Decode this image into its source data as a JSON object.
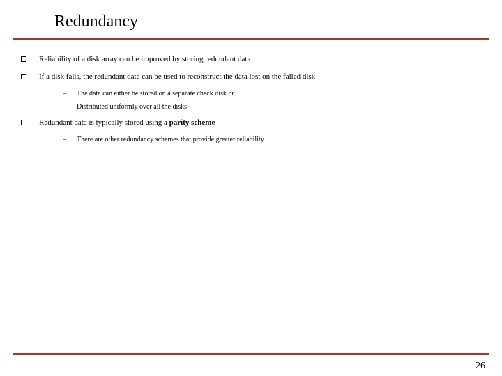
{
  "title": "Redundancy",
  "bullets": {
    "b1": "Reliability of a disk array can be improved by storing redundant data",
    "b2": "If a disk fails, the redundant data can be used to reconstruct the data lost on the failed disk",
    "b2s1": "The data can either be stored on a separate check disk or",
    "b2s2": "Distributed uniformly over all the disks",
    "b3_pre": "Redundant data is typically stored using a ",
    "b3_bold": "parity scheme",
    "b3s1": "There are other redundancy schemes that provide greater reliability"
  },
  "pageNumber": "26",
  "colors": {
    "rule": "#a0392a"
  }
}
